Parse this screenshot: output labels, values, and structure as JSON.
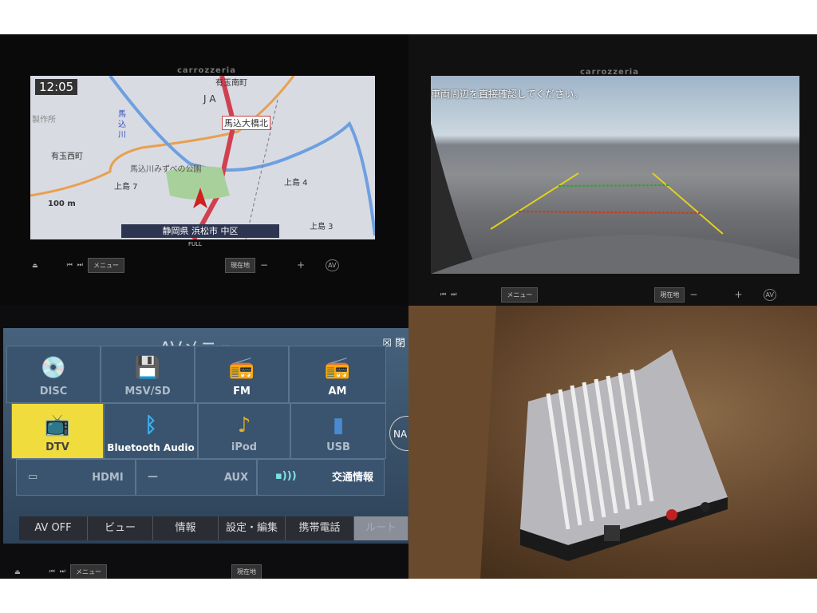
{
  "nav": {
    "brand": "carrozzeria",
    "clock": "12:05",
    "labels": [
      "有玉南町",
      "J A",
      "馬込大橋北",
      "馬込川",
      "製作所",
      "有玉西町",
      "馬込川みずべの公園",
      "上島 7",
      "上島 4",
      "上島 3",
      "100 m"
    ],
    "address": "静岡県 浜松市 中区",
    "full_label": "FULL",
    "buttons": {
      "menu": "メニュー",
      "current": "現在地",
      "minus": "−",
      "plus": "+",
      "av": "AV"
    }
  },
  "camera": {
    "brand": "carrozzeria",
    "warning": "車両周辺を直接確認してください。",
    "buttons": {
      "menu": "メニュー",
      "current": "現在地",
      "minus": "−",
      "plus": "+",
      "av": "AV"
    }
  },
  "av": {
    "title": "AVメニュー",
    "close": "閉",
    "sources": [
      {
        "label": "DISC",
        "icon": "disc-icon"
      },
      {
        "label": "MSV/SD",
        "icon": "sd-card-icon"
      },
      {
        "label": "FM",
        "icon": "radio-icon"
      },
      {
        "label": "AM",
        "icon": "radio-icon"
      },
      {
        "label": "DTV",
        "icon": "tv-icon",
        "selected": true
      },
      {
        "label": "Bluetooth Audio",
        "icon": "bluetooth-icon"
      },
      {
        "label": "iPod",
        "icon": "music-note-icon"
      },
      {
        "label": "USB",
        "icon": "usb-icon"
      },
      {
        "label": "HDMI",
        "icon": "hdmi-icon"
      },
      {
        "label": "AUX",
        "icon": "aux-icon"
      },
      {
        "label": "交通情報",
        "icon": "traffic-info-icon"
      }
    ],
    "tabs": [
      "AV OFF",
      "ビュー",
      "情報",
      "設定・編集",
      "携帯電話",
      "ルート"
    ],
    "nav_side": "NA",
    "accent": "#f0dc3c",
    "buttons": {
      "menu": "メニュー",
      "current": "現在地"
    }
  }
}
